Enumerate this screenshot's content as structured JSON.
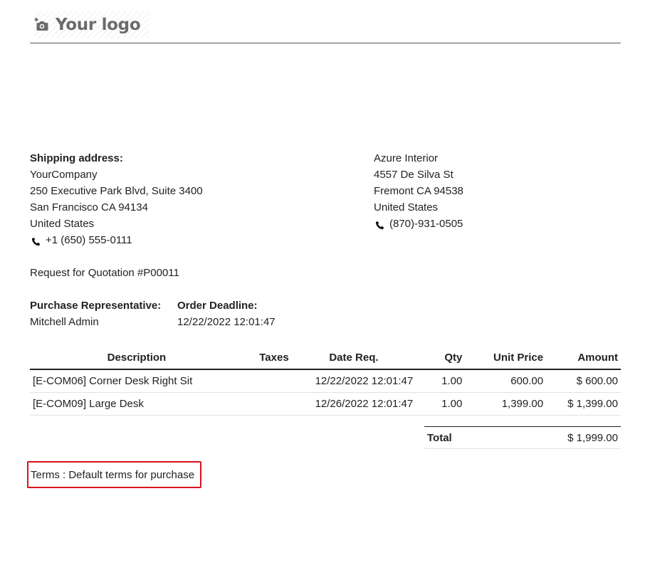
{
  "header": {
    "logo_text": "Your logo",
    "logo_icon": "camera-add-icon"
  },
  "shipping": {
    "heading": "Shipping address:",
    "name": "YourCompany",
    "street": "250 Executive Park Blvd, Suite 3400",
    "city": "San Francisco CA 94134",
    "country": "United States",
    "phone": "+1 (650) 555-0111",
    "phone_icon": "phone-icon"
  },
  "vendor": {
    "name": "Azure Interior",
    "street": "4557 De Silva St",
    "city": "Fremont CA 94538",
    "country": "United States",
    "phone": "(870)-931-0505",
    "phone_icon": "phone-icon"
  },
  "document": {
    "title": "Request for Quotation #P00011"
  },
  "info": {
    "representative_label": "Purchase Representative:",
    "representative_value": "Mitchell Admin",
    "deadline_label": "Order Deadline:",
    "deadline_value": "12/22/2022 12:01:47"
  },
  "table": {
    "headers": {
      "description": "Description",
      "taxes": "Taxes",
      "date_req": "Date Req.",
      "qty": "Qty",
      "unit_price": "Unit Price",
      "amount": "Amount"
    },
    "rows": [
      {
        "description": "[E-COM06] Corner Desk Right Sit",
        "taxes": "",
        "date_req": "12/22/2022 12:01:47",
        "qty": "1.00",
        "unit_price": "600.00",
        "amount": "$ 600.00"
      },
      {
        "description": "[E-COM09] Large Desk",
        "taxes": "",
        "date_req": "12/26/2022 12:01:47",
        "qty": "1.00",
        "unit_price": "1,399.00",
        "amount": "$ 1,399.00"
      }
    ]
  },
  "totals": {
    "label": "Total",
    "value": "$ 1,999.00"
  },
  "terms": {
    "text": "Terms : Default terms for purchase"
  },
  "colors": {
    "highlight_border": "#d9141e",
    "logo_text": "#6b6b6b",
    "text": "#222222"
  }
}
